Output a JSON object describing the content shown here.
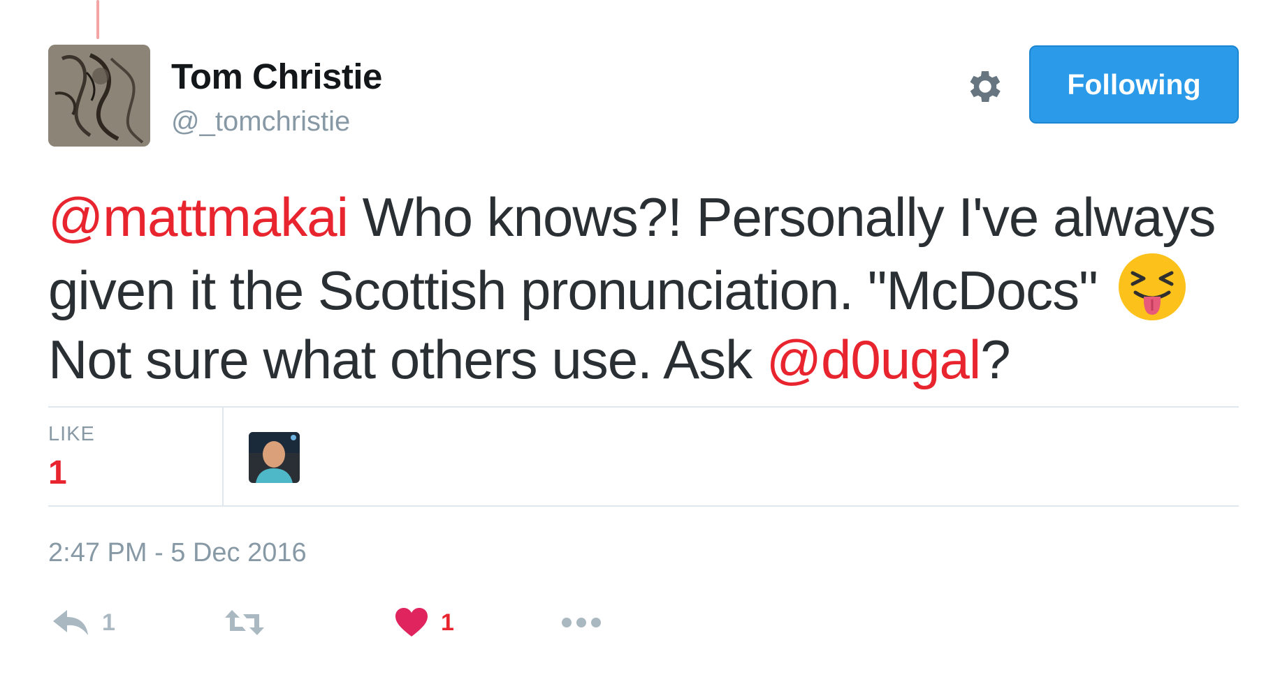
{
  "author": {
    "name": "Tom Christie",
    "handle": "@_tomchristie"
  },
  "follow_button": {
    "label": "Following",
    "color": "#2b9ae8"
  },
  "tweet": {
    "mention_1": "@mattmakai",
    "text_1": " Who knows?! Personally I've always given it the Scottish pronunciation. \"McDocs\"",
    "emoji": "squinting-face-with-tongue",
    "text_2": "Not sure what others use. Ask ",
    "mention_2": "@d0ugal",
    "text_3": "?"
  },
  "stats": {
    "like_label": "LIKE",
    "like_count": "1"
  },
  "timestamp": "2:47 PM - 5 Dec 2016",
  "actions": {
    "reply_count": "1",
    "retweet_count": "",
    "like_count": "1"
  },
  "colors": {
    "mention": "#e8242e",
    "muted": "#8899a6",
    "like": "#e0245e"
  }
}
